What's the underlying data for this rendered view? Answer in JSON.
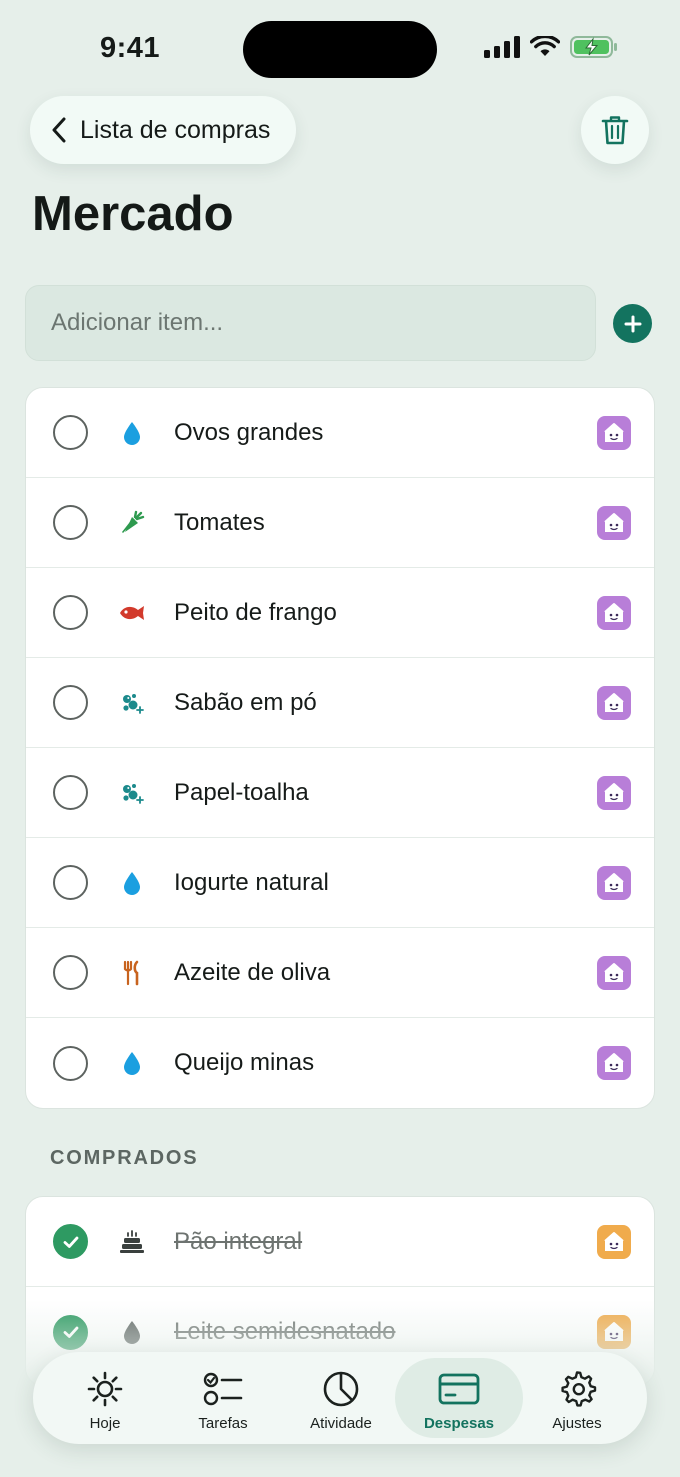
{
  "status": {
    "time": "9:41"
  },
  "header": {
    "back_label": "Lista de compras",
    "title": "Mercado"
  },
  "add_item": {
    "placeholder": "Adicionar item..."
  },
  "pending_items": [
    {
      "label": "Ovos grandes",
      "icon": "drop-icon",
      "assignee": "purple-avatar"
    },
    {
      "label": "Tomates",
      "icon": "carrot-icon",
      "assignee": "purple-avatar"
    },
    {
      "label": "Peito de frango",
      "icon": "fish-icon",
      "assignee": "purple-avatar"
    },
    {
      "label": "Sabão em pó",
      "icon": "bubbles-icon",
      "assignee": "purple-avatar"
    },
    {
      "label": "Papel-toalha",
      "icon": "bubbles-icon",
      "assignee": "purple-avatar"
    },
    {
      "label": "Iogurte natural",
      "icon": "drop-icon",
      "assignee": "purple-avatar"
    },
    {
      "label": "Azeite de oliva",
      "icon": "utensils-icon",
      "assignee": "purple-avatar"
    },
    {
      "label": "Queijo minas",
      "icon": "drop-icon",
      "assignee": "purple-avatar"
    }
  ],
  "bought_section": {
    "title": "COMPRADOS",
    "items": [
      {
        "label": "Pão integral",
        "icon": "cake-icon",
        "assignee": "orange-avatar"
      },
      {
        "label": "Leite semidesnatado",
        "icon": "drop-gray-icon",
        "assignee": "orange-avatar"
      }
    ]
  },
  "tabs": [
    {
      "label": "Hoje",
      "icon": "sun-icon"
    },
    {
      "label": "Tarefas",
      "icon": "checklist-icon"
    },
    {
      "label": "Atividade",
      "icon": "pie-chart-icon"
    },
    {
      "label": "Despesas",
      "icon": "credit-card-icon",
      "active": true
    },
    {
      "label": "Ajustes",
      "icon": "gear-icon"
    }
  ],
  "colors": {
    "accent": "#13735f",
    "background": "#e6efea",
    "check_done": "#2e9a62",
    "avatar_purple": "#b87ed8",
    "avatar_orange": "#f0ab4c"
  }
}
